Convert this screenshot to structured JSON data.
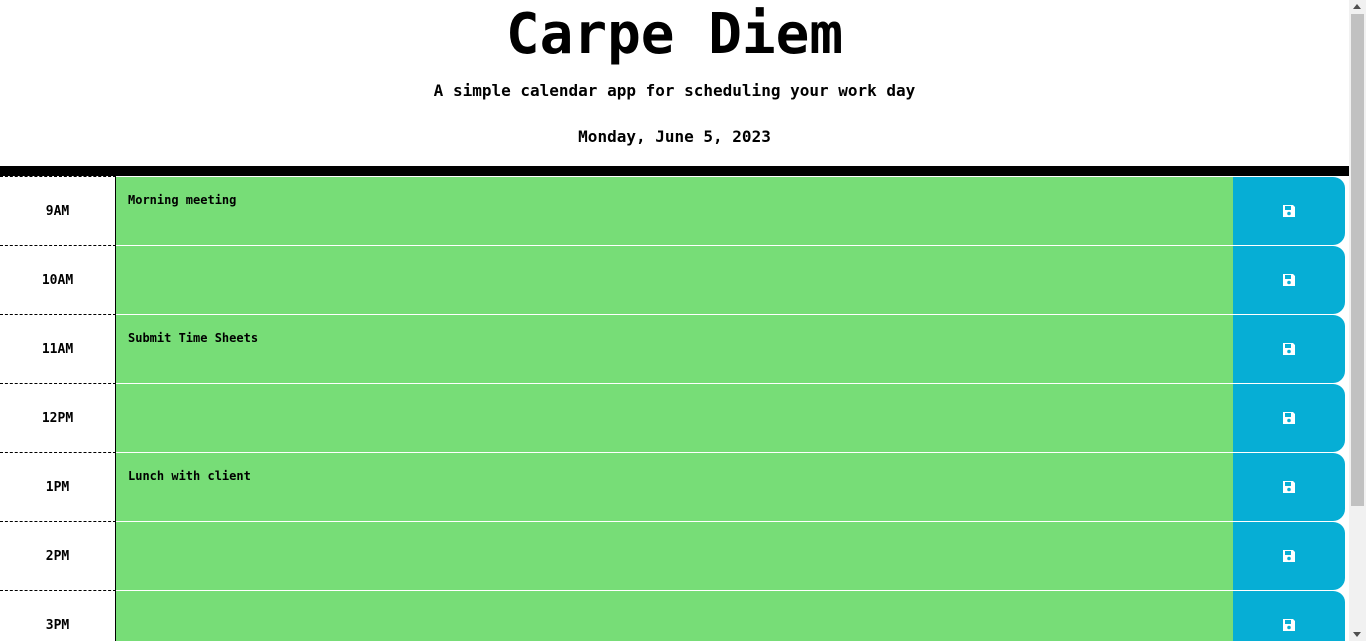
{
  "header": {
    "title": "Carpe Diem",
    "subtitle": "A simple calendar app for scheduling your work day",
    "current_day": "Monday, June 5, 2023"
  },
  "colors": {
    "present_past_future_block": "#77dd77",
    "save_button": "#06aed5",
    "header_border": "#000000"
  },
  "time_blocks": [
    {
      "hour": "9AM",
      "description": "Morning meeting",
      "save_icon": "floppy-disk-icon"
    },
    {
      "hour": "10AM",
      "description": "",
      "save_icon": "floppy-disk-icon"
    },
    {
      "hour": "11AM",
      "description": "Submit Time Sheets",
      "save_icon": "floppy-disk-icon"
    },
    {
      "hour": "12PM",
      "description": "",
      "save_icon": "floppy-disk-icon"
    },
    {
      "hour": "1PM",
      "description": "Lunch with client",
      "save_icon": "floppy-disk-icon"
    },
    {
      "hour": "2PM",
      "description": "",
      "save_icon": "floppy-disk-icon"
    },
    {
      "hour": "3PM",
      "description": "",
      "save_icon": "floppy-disk-icon"
    }
  ]
}
